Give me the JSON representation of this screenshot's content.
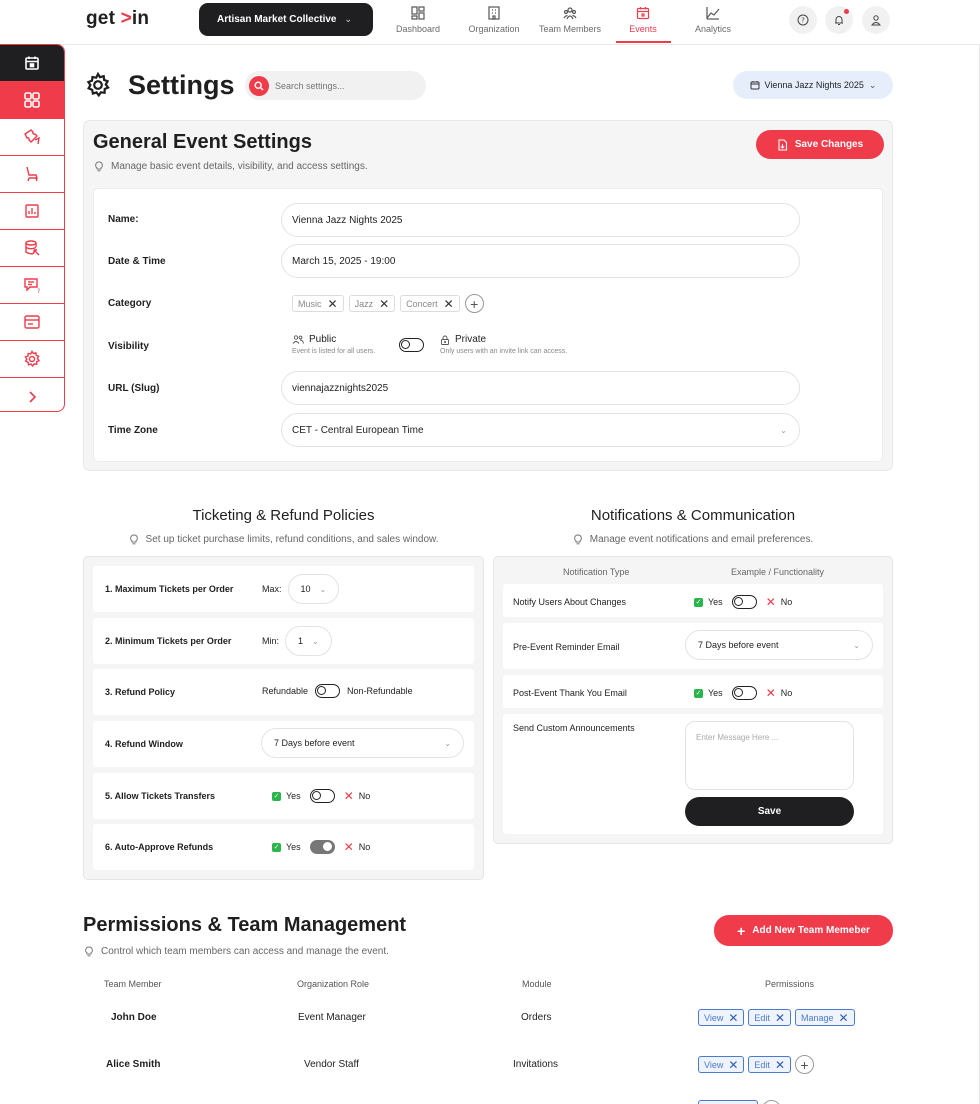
{
  "brand": {
    "logo_left": "get",
    "logo_arrow": ">",
    "logo_right": "in",
    "accent": "#ef3b4a"
  },
  "org_switch": {
    "label": "Artisan Market Collective"
  },
  "nav": [
    {
      "label": "Dashboard",
      "icon": "dashboard-icon"
    },
    {
      "label": "Organization",
      "icon": "building-icon"
    },
    {
      "label": "Team Members",
      "icon": "team-icon"
    },
    {
      "label": "Events",
      "icon": "calendar-icon",
      "active": true
    },
    {
      "label": "Analytics",
      "icon": "chart-icon"
    }
  ],
  "header": {
    "title": "Settings",
    "search_placeholder": "Search settings...",
    "event_selected": "Vienna Jazz Nights 2025"
  },
  "general": {
    "title": "General Event Settings",
    "hint": "Manage basic event details, visibility, and access settings.",
    "save_label": "Save Changes",
    "name_label": "Name:",
    "name_value": "Vienna Jazz Nights 2025",
    "date_label": "Date & Time",
    "date_value": "March 15, 2025 - 19:00",
    "category_label": "Category",
    "categories": [
      "Music",
      "Jazz",
      "Concert"
    ],
    "visibility_label": "Visibility",
    "public_label": "Public",
    "public_desc": "Event is listed for all users.",
    "private_label": "Private",
    "private_desc": "Only users with an invite link can access.",
    "url_label": "URL (Slug)",
    "url_value": "viennajazznights2025",
    "tz_label": "Time Zone",
    "tz_value": "CET - Central European Time"
  },
  "ticketing": {
    "title": "Ticketing & Refund Policies",
    "hint": "Set up ticket purchase limits, refund conditions, and sales window.",
    "max_label": "1. Maximum Tickets per Order",
    "max_prefix": "Max:",
    "max_value": "10",
    "min_label": "2. Minimum Tickets per Order",
    "min_prefix": "Min:",
    "min_value": "1",
    "refund_policy_label": "3. Refund Policy",
    "refundable": "Refundable",
    "non_refundable": "Non-Refundable",
    "refund_window_label": "4. Refund Window",
    "refund_window_value": "7 Days before event",
    "transfers_label": "5. Allow Tickets Transfers",
    "auto_approve_label": "6. Auto-Approve Refunds",
    "yes": "Yes",
    "no": "No"
  },
  "notifications": {
    "title": "Notifications & Communication",
    "hint": "Manage event notifications and email preferences.",
    "col_type": "Notification Type",
    "col_func": "Example / Functionality",
    "notify_label": "Notify Users About Changes",
    "reminder_label": "Pre-Event Reminder Email",
    "reminder_value": "7 Days before event",
    "thankyou_label": "Post-Event Thank You Email",
    "custom_label": "Send Custom Announcements",
    "message_placeholder": "Enter Message Here ...",
    "save_label": "Save",
    "yes": "Yes",
    "no": "No"
  },
  "permissions": {
    "title": "Permissions & Team Management",
    "hint": "Control which team members can access and manage the event.",
    "add_label": "Add New Team Memeber",
    "headers": [
      "Team Member",
      "Organization Role",
      "Module",
      "Permissions"
    ],
    "rows": [
      {
        "member": "John Doe",
        "role": "Event Manager",
        "module": "Orders",
        "perms": [
          "View",
          "Edit",
          "Manage"
        ]
      },
      {
        "member": "Alice Smith",
        "role": "Vendor Staff",
        "module": "Invitations",
        "perms": [
          "View",
          "Edit"
        ]
      }
    ]
  }
}
